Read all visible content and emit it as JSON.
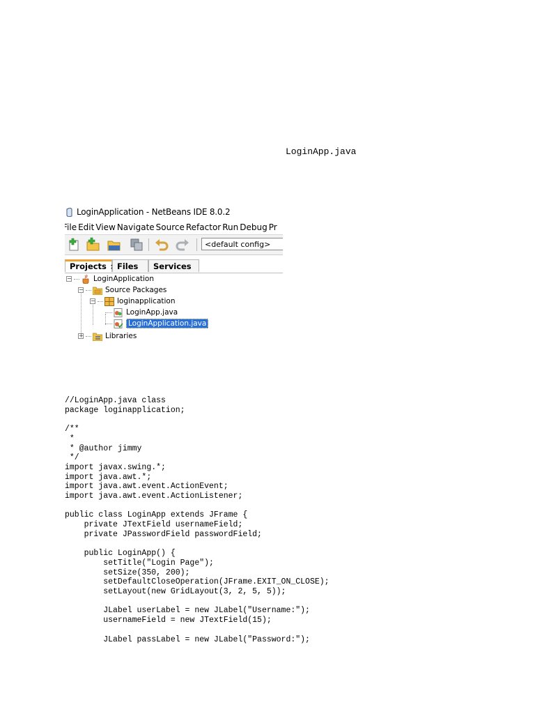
{
  "heading": "LoginApp.java",
  "ide": {
    "window_title": "LoginApplication - NetBeans IDE 8.0.2",
    "menu": [
      "File",
      "Edit",
      "View",
      "Navigate",
      "Source",
      "Refactor",
      "Run",
      "Debug",
      "Pr"
    ],
    "config_value": "<default config>",
    "tabs": {
      "projects": "Projects",
      "close": "×",
      "files": "Files",
      "services": "Services"
    },
    "tree": {
      "project": "LoginApplication",
      "source_packages": "Source Packages",
      "package": "loginapplication",
      "file1": "LoginApp.java",
      "file2": "LoginApplication.java",
      "libraries": "Libraries"
    }
  },
  "code": "//LoginApp.java class\npackage loginapplication;\n\n/**\n *\n * @author jimmy\n */\nimport javax.swing.*;\nimport java.awt.*;\nimport java.awt.event.ActionEvent;\nimport java.awt.event.ActionListener;\n\npublic class LoginApp extends JFrame {\n    private JTextField usernameField;\n    private JPasswordField passwordField;\n\n    public LoginApp() {\n        setTitle(\"Login Page\");\n        setSize(350, 200);\n        setDefaultCloseOperation(JFrame.EXIT_ON_CLOSE);\n        setLayout(new GridLayout(3, 2, 5, 5));\n\n        JLabel userLabel = new JLabel(\"Username:\");\n        usernameField = new JTextField(15);\n\n        JLabel passLabel = new JLabel(\"Password:\");"
}
